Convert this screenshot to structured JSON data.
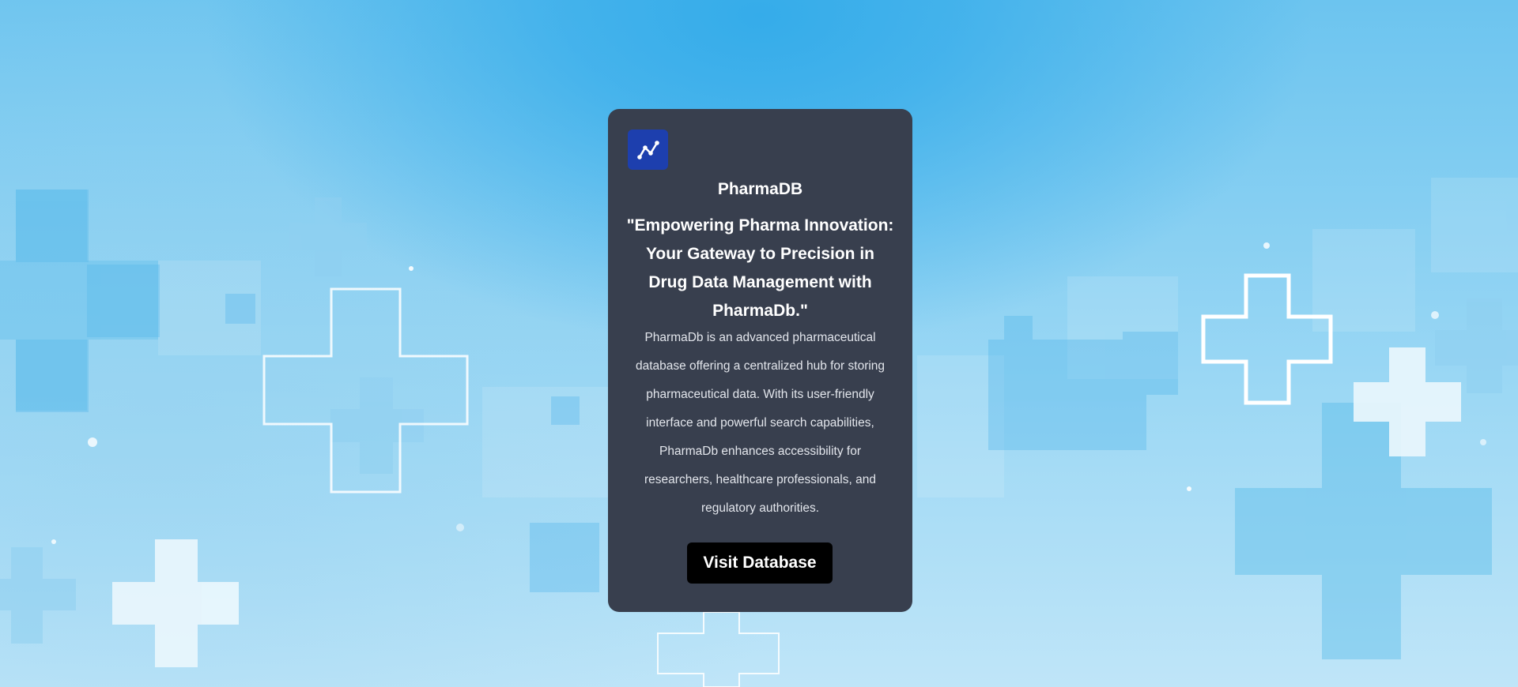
{
  "card": {
    "logo_icon": "chart-line-icon",
    "app_name": "PharmaDB",
    "tagline": "\"Empowering Pharma Innovation: Your Gateway to Precision in Drug Data Management with PharmaDb.\"",
    "description": "PharmaDb is an advanced pharmaceutical database offering a centralized hub for storing pharmaceutical data. With its user-friendly interface and powerful search capabilities, PharmaDb enhances accessibility for researchers, healthcare professionals, and regulatory authorities.",
    "button_label": "Visit Database"
  },
  "background": {
    "decoration": "medical-cross-pattern"
  },
  "colors": {
    "card_bg": "#383f4e",
    "logo_bg": "#1d3fae",
    "button_bg": "#000000",
    "sky_blue": "#35acea"
  }
}
